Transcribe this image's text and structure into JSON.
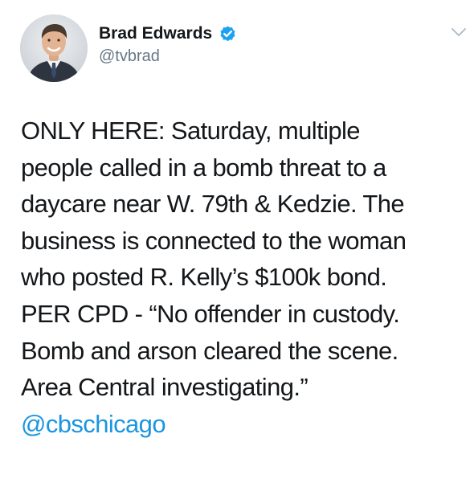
{
  "user": {
    "display_name": "Brad Edwards",
    "handle": "@tvbrad",
    "verified": true
  },
  "tweet": {
    "lines": [
      "ONLY HERE: Saturday, multiple",
      "people called in a bomb threat to a",
      "daycare near W. 79th & Kedzie. The",
      "business is connected to the woman",
      "who posted R. Kelly’s $100k bond.",
      "PER CPD - “No offender in custody.",
      "Bomb and arson cleared the scene.",
      "Area Central investigating.”"
    ],
    "mention": "@cbschicago"
  },
  "icons": {
    "verified": "verified-badge-icon",
    "menu": "chevron-down-icon"
  },
  "colors": {
    "text": "#14171a",
    "secondary": "#657786",
    "link": "#1b95e0",
    "verified": "#1da1f2"
  }
}
